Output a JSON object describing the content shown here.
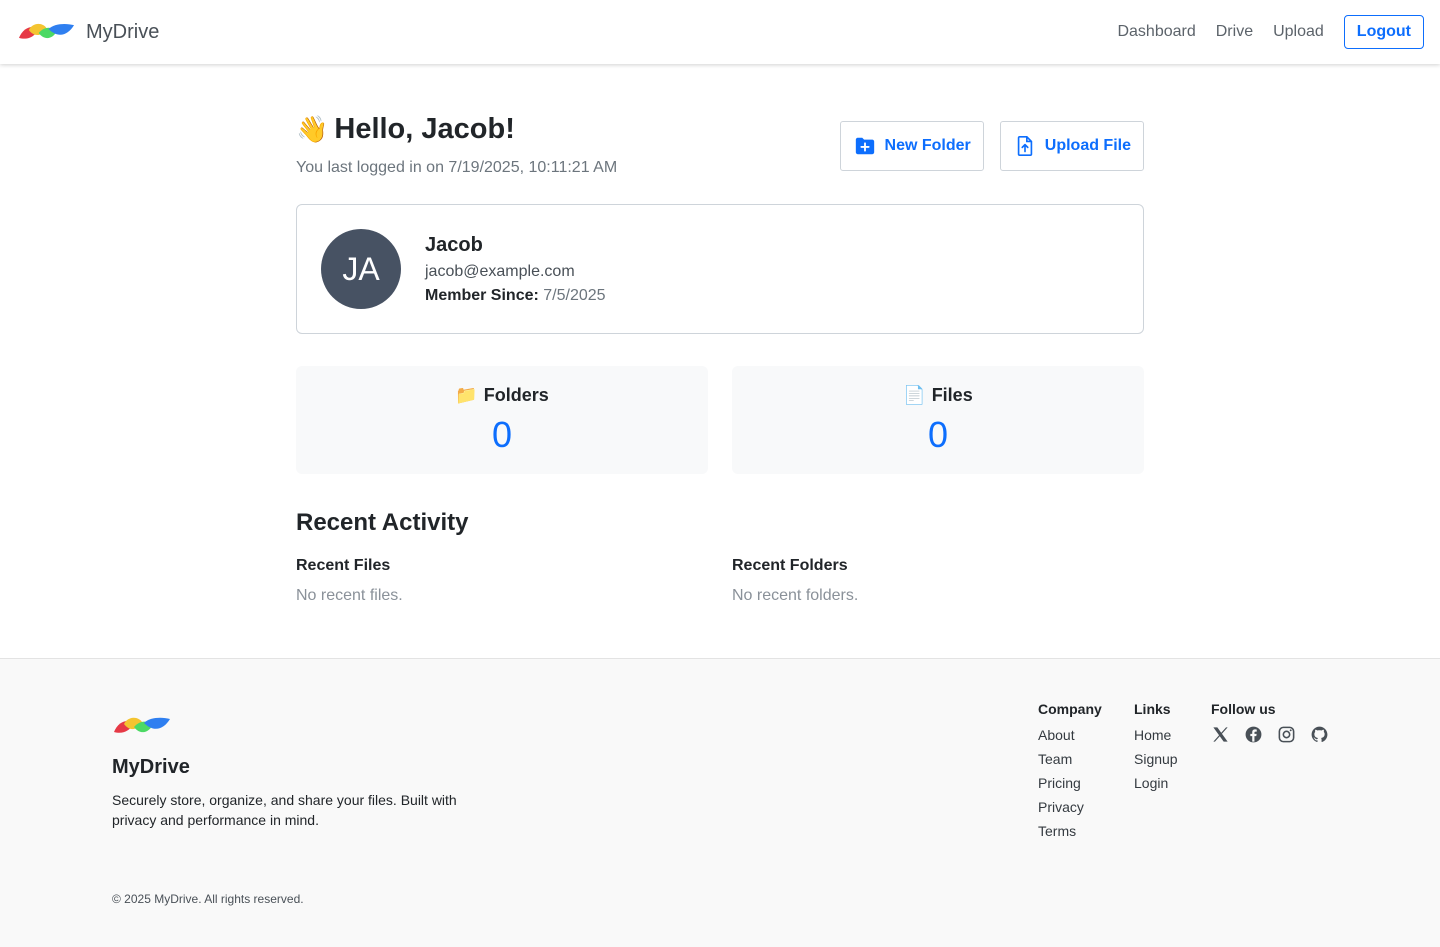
{
  "nav": {
    "brand": "MyDrive",
    "links": [
      "Dashboard",
      "Drive",
      "Upload"
    ],
    "logout": "Logout"
  },
  "main": {
    "greeting_emoji": "👋",
    "greeting": "Hello, Jacob!",
    "last_login": "You last logged in on 7/19/2025, 10:11:21 AM",
    "new_folder": "New Folder",
    "upload_file": "Upload File"
  },
  "profile": {
    "initials": "JA",
    "name": "Jacob",
    "email": "jacob@example.com",
    "member_since_label": "Member Since:",
    "member_since": "7/5/2025"
  },
  "stats": {
    "folders_icon": "📁",
    "folders_label": "Folders",
    "folders_count": "0",
    "files_icon": "📄",
    "files_label": "Files",
    "files_count": "0"
  },
  "recent": {
    "title": "Recent Activity",
    "files_heading": "Recent Files",
    "files_empty": "No recent files.",
    "folders_heading": "Recent Folders",
    "folders_empty": "No recent folders."
  },
  "footer": {
    "brand": "MyDrive",
    "description": "Securely store, organize, and share your files. Built with privacy and performance in mind.",
    "company_heading": "Company",
    "company_links": [
      "About",
      "Team",
      "Pricing",
      "Privacy",
      "Terms"
    ],
    "links_heading": "Links",
    "links": [
      "Home",
      "Signup",
      "Login"
    ],
    "follow_heading": "Follow us",
    "social_icons": [
      "x-icon",
      "facebook-icon",
      "instagram-icon",
      "github-icon"
    ],
    "copyright": "© 2025 MyDrive. All rights reserved."
  },
  "colors": {
    "accent": "#0d6efd",
    "avatar_bg": "#475263",
    "logo_red": "#e63946",
    "logo_yellow": "#f4c430",
    "logo_green": "#4cd964",
    "logo_blue": "#2f7ff0"
  }
}
